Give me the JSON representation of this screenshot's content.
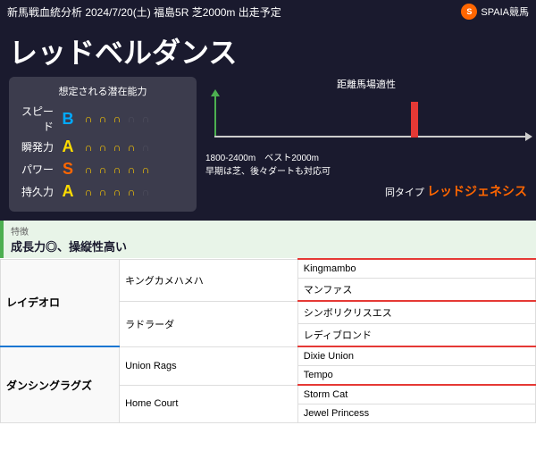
{
  "header": {
    "title": "新馬戦血統分析 2024/7/20(土) 福島5R 芝2000m 出走予定",
    "logo_text": "SPAIA競馬"
  },
  "horse": {
    "name": "レッドベルダンス",
    "ability_title": "想定される潜在能力",
    "abilities": [
      {
        "label": "スピード",
        "grade": "B",
        "grade_class": "grade-b",
        "filled": 3,
        "total": 5
      },
      {
        "label": "瞬発力",
        "grade": "A",
        "grade_class": "grade-a",
        "filled": 4,
        "total": 5
      },
      {
        "label": "パワー",
        "grade": "S",
        "grade_class": "grade-s",
        "filled": 5,
        "total": 5
      },
      {
        "label": "持久力",
        "grade": "A",
        "grade_class": "grade-a",
        "filled": 4,
        "total": 5
      }
    ],
    "distance_title": "距離馬場適性",
    "distance_range": "1800-2400m　ベスト2000m",
    "distance_note": "早期は芝、後々ダートも対応可",
    "same_type_label": "同タイプ",
    "same_type_name": "レッドジェネシス",
    "features_label": "特徴",
    "features_text": "成長力◎、操縦性高い"
  },
  "pedigree": {
    "rows": [
      {
        "g1": "レイデオロ",
        "g1_rowspan": 4,
        "g2": "キングカメハメハ",
        "g2_rowspan": 2,
        "g3": "Kingmambo",
        "g3_border": "red"
      },
      {
        "g3": "マンファス",
        "g3_border": ""
      },
      {
        "g2": "ラドラーダ",
        "g2_rowspan": 2,
        "g3": "シンボリクリスエス",
        "g3_border": "red"
      },
      {
        "g3": "レディブロンド",
        "g3_border": ""
      },
      {
        "g1": "ダンシングラグズ",
        "g1_rowspan": 4,
        "g2": "Union Rags",
        "g2_rowspan": 2,
        "g3": "Dixie Union",
        "g3_border": "red"
      },
      {
        "g3": "Tempo",
        "g3_border": ""
      },
      {
        "g2": "Home Court",
        "g2_rowspan": 2,
        "g3": "Storm Cat",
        "g3_border": "red"
      },
      {
        "g3": "Jewel Princess",
        "g3_border": ""
      }
    ]
  }
}
